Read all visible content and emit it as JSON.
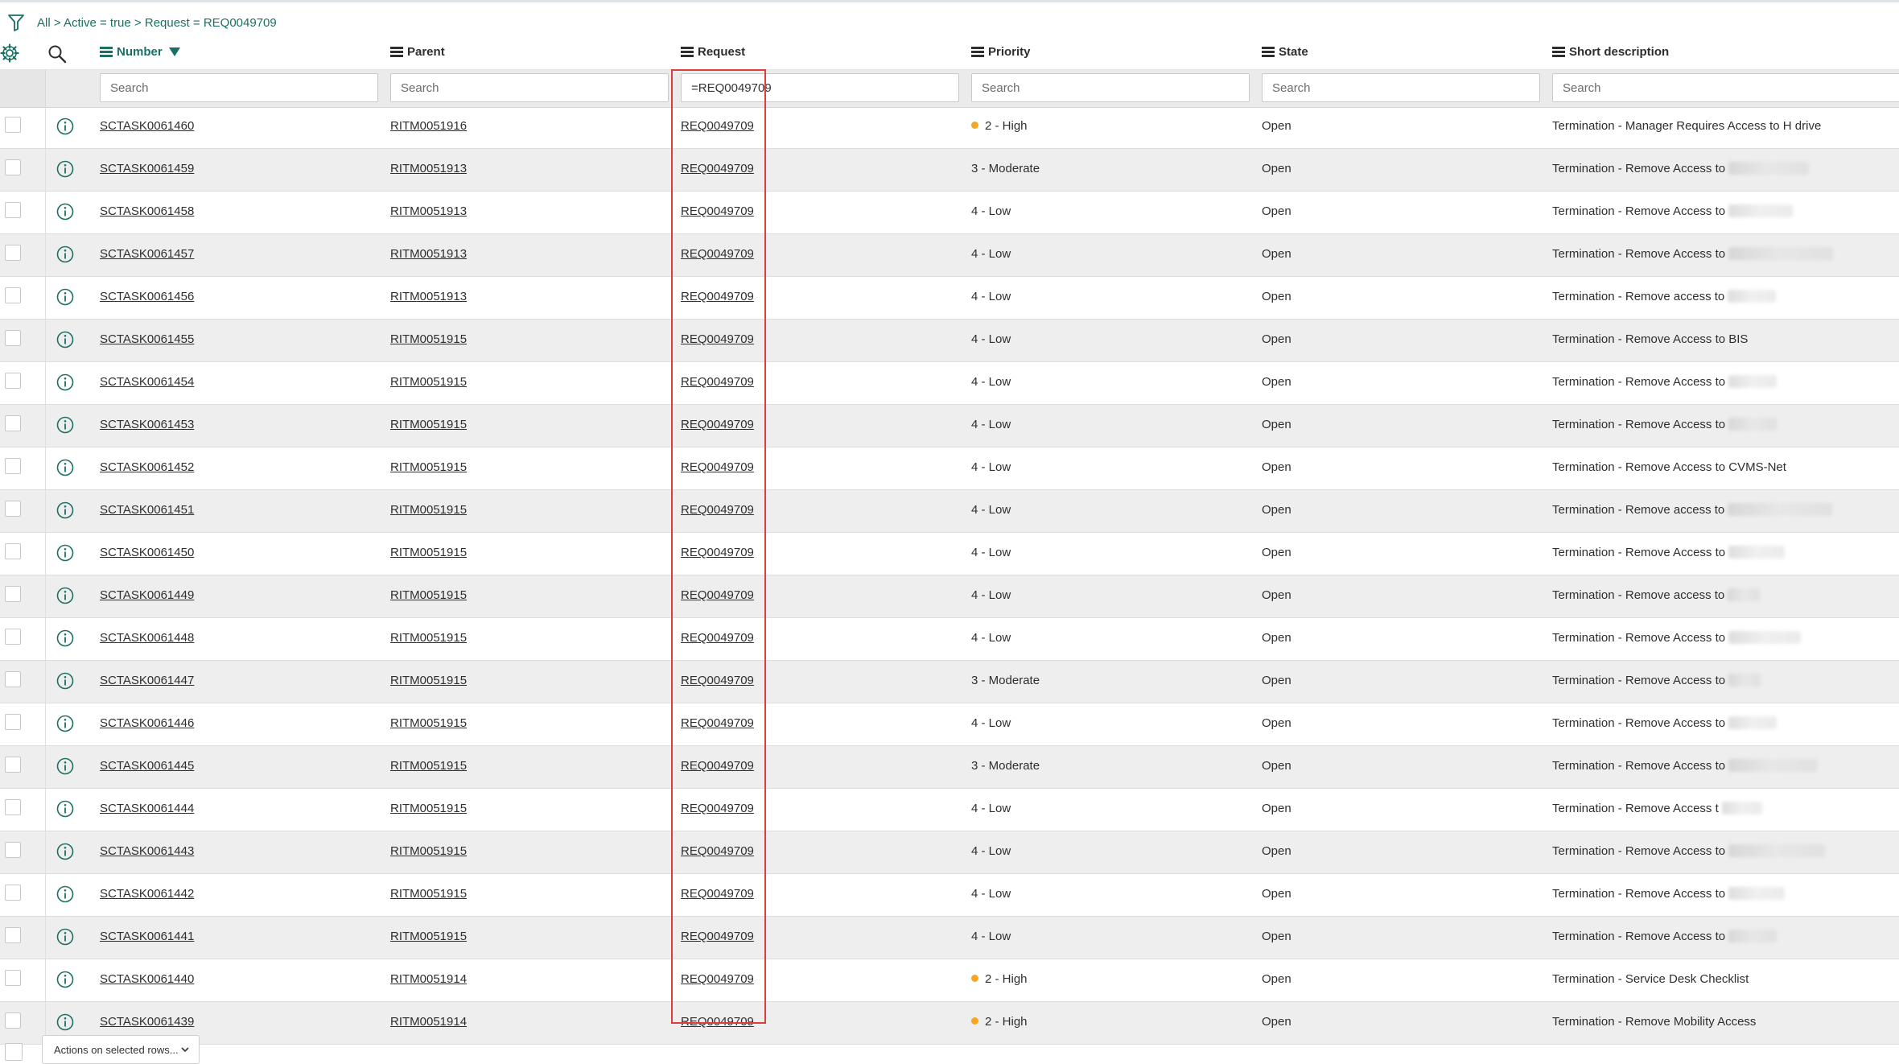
{
  "breadcrumb": {
    "items": [
      "All",
      "Active = true",
      "Request = REQ0049709"
    ],
    "separator": " > "
  },
  "columns": [
    {
      "key": "number",
      "label": "Number",
      "sorted": "descending"
    },
    {
      "key": "parent",
      "label": "Parent"
    },
    {
      "key": "request",
      "label": "Request"
    },
    {
      "key": "priority",
      "label": "Priority"
    },
    {
      "key": "state",
      "label": "State"
    },
    {
      "key": "short_description",
      "label": "Short description"
    }
  ],
  "filters": {
    "number": {
      "value": "",
      "placeholder": "Search"
    },
    "parent": {
      "value": "",
      "placeholder": "Search"
    },
    "request": {
      "value": "=REQ0049709",
      "placeholder": "Search"
    },
    "priority": {
      "value": "",
      "placeholder": "Search"
    },
    "state": {
      "value": "",
      "placeholder": "Search"
    },
    "short_description": {
      "value": "",
      "placeholder": "Search"
    }
  },
  "rows": [
    {
      "number": "SCTASK0061460",
      "parent": "RITM0051916",
      "request": "REQ0049709",
      "priority": "2 - High",
      "high": true,
      "state": "Open",
      "desc": "Termination - Manager Requires Access to H drive",
      "redacted": false
    },
    {
      "number": "SCTASK0061459",
      "parent": "RITM0051913",
      "request": "REQ0049709",
      "priority": "3 - Moderate",
      "high": false,
      "state": "Open",
      "desc": "Termination - Remove Access to",
      "redacted": true
    },
    {
      "number": "SCTASK0061458",
      "parent": "RITM0051913",
      "request": "REQ0049709",
      "priority": "4 - Low",
      "high": false,
      "state": "Open",
      "desc": "Termination - Remove Access to",
      "redacted": true
    },
    {
      "number": "SCTASK0061457",
      "parent": "RITM0051913",
      "request": "REQ0049709",
      "priority": "4 - Low",
      "high": false,
      "state": "Open",
      "desc": "Termination - Remove Access to",
      "redacted": true
    },
    {
      "number": "SCTASK0061456",
      "parent": "RITM0051913",
      "request": "REQ0049709",
      "priority": "4 - Low",
      "high": false,
      "state": "Open",
      "desc": "Termination - Remove access to",
      "redacted": true
    },
    {
      "number": "SCTASK0061455",
      "parent": "RITM0051915",
      "request": "REQ0049709",
      "priority": "4 - Low",
      "high": false,
      "state": "Open",
      "desc": "Termination - Remove Access to BIS",
      "redacted": false
    },
    {
      "number": "SCTASK0061454",
      "parent": "RITM0051915",
      "request": "REQ0049709",
      "priority": "4 - Low",
      "high": false,
      "state": "Open",
      "desc": "Termination - Remove Access to",
      "redacted": true
    },
    {
      "number": "SCTASK0061453",
      "parent": "RITM0051915",
      "request": "REQ0049709",
      "priority": "4 - Low",
      "high": false,
      "state": "Open",
      "desc": "Termination - Remove Access to",
      "redacted": true
    },
    {
      "number": "SCTASK0061452",
      "parent": "RITM0051915",
      "request": "REQ0049709",
      "priority": "4 - Low",
      "high": false,
      "state": "Open",
      "desc": "Termination - Remove Access to CVMS-Net",
      "redacted": false
    },
    {
      "number": "SCTASK0061451",
      "parent": "RITM0051915",
      "request": "REQ0049709",
      "priority": "4 - Low",
      "high": false,
      "state": "Open",
      "desc": "Termination - Remove access to",
      "redacted": true
    },
    {
      "number": "SCTASK0061450",
      "parent": "RITM0051915",
      "request": "REQ0049709",
      "priority": "4 - Low",
      "high": false,
      "state": "Open",
      "desc": "Termination - Remove Access to",
      "redacted": true
    },
    {
      "number": "SCTASK0061449",
      "parent": "RITM0051915",
      "request": "REQ0049709",
      "priority": "4 - Low",
      "high": false,
      "state": "Open",
      "desc": "Termination - Remove access to",
      "redacted": true
    },
    {
      "number": "SCTASK0061448",
      "parent": "RITM0051915",
      "request": "REQ0049709",
      "priority": "4 - Low",
      "high": false,
      "state": "Open",
      "desc": "Termination - Remove Access to",
      "redacted": true
    },
    {
      "number": "SCTASK0061447",
      "parent": "RITM0051915",
      "request": "REQ0049709",
      "priority": "3 - Moderate",
      "high": false,
      "state": "Open",
      "desc": "Termination - Remove Access to",
      "redacted": true
    },
    {
      "number": "SCTASK0061446",
      "parent": "RITM0051915",
      "request": "REQ0049709",
      "priority": "4 - Low",
      "high": false,
      "state": "Open",
      "desc": "Termination - Remove Access to",
      "redacted": true
    },
    {
      "number": "SCTASK0061445",
      "parent": "RITM0051915",
      "request": "REQ0049709",
      "priority": "3 - Moderate",
      "high": false,
      "state": "Open",
      "desc": "Termination - Remove Access to",
      "redacted": true
    },
    {
      "number": "SCTASK0061444",
      "parent": "RITM0051915",
      "request": "REQ0049709",
      "priority": "4 - Low",
      "high": false,
      "state": "Open",
      "desc": "Termination - Remove Access t",
      "redacted": true
    },
    {
      "number": "SCTASK0061443",
      "parent": "RITM0051915",
      "request": "REQ0049709",
      "priority": "4 - Low",
      "high": false,
      "state": "Open",
      "desc": "Termination - Remove Access to",
      "redacted": true
    },
    {
      "number": "SCTASK0061442",
      "parent": "RITM0051915",
      "request": "REQ0049709",
      "priority": "4 - Low",
      "high": false,
      "state": "Open",
      "desc": "Termination - Remove Access to",
      "redacted": true
    },
    {
      "number": "SCTASK0061441",
      "parent": "RITM0051915",
      "request": "REQ0049709",
      "priority": "4 - Low",
      "high": false,
      "state": "Open",
      "desc": "Termination - Remove Access to",
      "redacted": true
    },
    {
      "number": "SCTASK0061440",
      "parent": "RITM0051914",
      "request": "REQ0049709",
      "priority": "2 - High",
      "high": true,
      "state": "Open",
      "desc": "Termination - Service Desk Checklist",
      "redacted": false
    },
    {
      "number": "SCTASK0061439",
      "parent": "RITM0051914",
      "request": "REQ0049709",
      "priority": "2 - High",
      "high": true,
      "state": "Open",
      "desc": "Termination - Remove Mobility Access",
      "redacted": false
    }
  ],
  "footer": {
    "actions_label": "Actions on selected rows..."
  },
  "colors": {
    "accent": "#1c6f63",
    "highlight": "#d9403b",
    "priority_high": "#f5a623"
  }
}
